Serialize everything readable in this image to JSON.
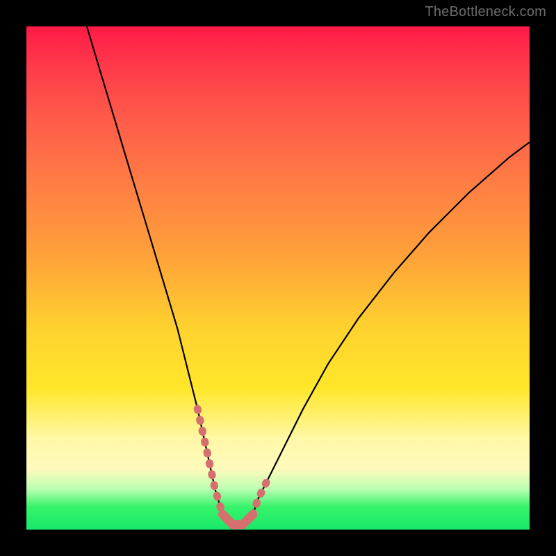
{
  "watermark": "TheBottleneck.com",
  "chart_data": {
    "type": "line",
    "title": "",
    "xlabel": "",
    "ylabel": "",
    "xlim": [
      0,
      100
    ],
    "ylim": [
      0,
      100
    ],
    "series": [
      {
        "name": "bottleneck-curve",
        "x": [
          12,
          15,
          18,
          21,
          24,
          27,
          30,
          32,
          34,
          36,
          37.5,
          39,
          41,
          43,
          45,
          46,
          50,
          55,
          60,
          66,
          73,
          80,
          88,
          96,
          100
        ],
        "values": [
          100,
          90,
          80,
          70,
          60,
          50,
          40,
          32,
          24,
          15,
          8,
          3,
          1,
          1,
          3,
          6,
          14,
          24,
          33,
          42,
          51,
          59,
          67,
          74,
          77
        ]
      }
    ],
    "highlight_segments": [
      {
        "x": [
          34,
          36,
          37.5,
          39
        ],
        "values": [
          24,
          15,
          8,
          3
        ]
      },
      {
        "x": [
          45,
          46,
          48
        ],
        "values": [
          3,
          6,
          10
        ]
      }
    ],
    "highlight_bottom": {
      "x": [
        39,
        41,
        43,
        45
      ],
      "values": [
        3,
        1,
        1,
        3
      ]
    },
    "colors": {
      "curve": "#000000",
      "highlight": "#d6706e",
      "gradient_top": "#ff1a47",
      "gradient_mid": "#ffd22e",
      "gradient_bottom": "#18e86a"
    }
  }
}
